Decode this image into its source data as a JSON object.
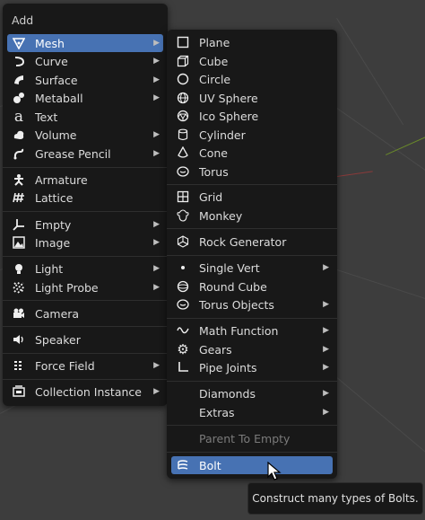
{
  "add_menu": {
    "title": "Add",
    "items": [
      {
        "label": "Mesh",
        "icon": "mesh-triangle-icon",
        "submenu": true,
        "selected": true
      },
      {
        "label": "Curve",
        "icon": "curve-icon",
        "submenu": true
      },
      {
        "label": "Surface",
        "icon": "surface-icon",
        "submenu": true
      },
      {
        "label": "Metaball",
        "icon": "metaball-icon",
        "submenu": true
      },
      {
        "label": "Text",
        "icon": "text-icon",
        "submenu": false
      },
      {
        "label": "Volume",
        "icon": "volume-icon",
        "submenu": true
      },
      {
        "label": "Grease Pencil",
        "icon": "grease-pencil-icon",
        "submenu": true
      },
      {
        "label": "Armature",
        "icon": "armature-icon",
        "submenu": false
      },
      {
        "label": "Lattice",
        "icon": "lattice-icon",
        "submenu": false
      },
      {
        "label": "Empty",
        "icon": "empty-icon",
        "submenu": true
      },
      {
        "label": "Image",
        "icon": "image-icon",
        "submenu": true
      },
      {
        "label": "Light",
        "icon": "light-icon",
        "submenu": true
      },
      {
        "label": "Light Probe",
        "icon": "light-probe-icon",
        "submenu": true
      },
      {
        "label": "Camera",
        "icon": "camera-icon",
        "submenu": false
      },
      {
        "label": "Speaker",
        "icon": "speaker-icon",
        "submenu": false
      },
      {
        "label": "Force Field",
        "icon": "force-field-icon",
        "submenu": true
      },
      {
        "label": "Collection Instance",
        "icon": "collection-instance-icon",
        "submenu": true
      }
    ]
  },
  "mesh_menu": {
    "items": [
      {
        "label": "Plane",
        "icon": "plane-icon",
        "submenu": false
      },
      {
        "label": "Cube",
        "icon": "cube-icon",
        "submenu": false
      },
      {
        "label": "Circle",
        "icon": "circle-icon",
        "submenu": false
      },
      {
        "label": "UV Sphere",
        "icon": "uv-sphere-icon",
        "submenu": false
      },
      {
        "label": "Ico Sphere",
        "icon": "ico-sphere-icon",
        "submenu": false
      },
      {
        "label": "Cylinder",
        "icon": "cylinder-icon",
        "submenu": false
      },
      {
        "label": "Cone",
        "icon": "cone-icon",
        "submenu": false
      },
      {
        "label": "Torus",
        "icon": "torus-icon",
        "submenu": false
      },
      {
        "label": "Grid",
        "icon": "grid-icon",
        "submenu": false
      },
      {
        "label": "Monkey",
        "icon": "monkey-icon",
        "submenu": false
      },
      {
        "label": "Rock Generator",
        "icon": "rock-generator-icon",
        "submenu": false
      },
      {
        "label": "Single Vert",
        "icon": "single-vert-icon",
        "submenu": true
      },
      {
        "label": "Round Cube",
        "icon": "round-cube-icon",
        "submenu": false
      },
      {
        "label": "Torus Objects",
        "icon": "torus-objects-icon",
        "submenu": true
      },
      {
        "label": "Math Function",
        "icon": "math-function-icon",
        "submenu": true
      },
      {
        "label": "Gears",
        "icon": "gears-icon",
        "submenu": true
      },
      {
        "label": "Pipe Joints",
        "icon": "pipe-joints-icon",
        "submenu": true
      },
      {
        "label": "Diamonds",
        "icon": "",
        "submenu": true
      },
      {
        "label": "Extras",
        "icon": "",
        "submenu": true
      },
      {
        "label": "Parent To Empty",
        "icon": "",
        "submenu": false,
        "disabled": true
      },
      {
        "label": "Bolt",
        "icon": "bolt-icon",
        "submenu": false,
        "selected": true
      }
    ]
  },
  "tooltip": {
    "text": "Construct many types of Bolts."
  },
  "colors": {
    "highlight": "#4772b3",
    "menu_bg": "#181818",
    "viewport_bg": "#3d3d3d"
  }
}
